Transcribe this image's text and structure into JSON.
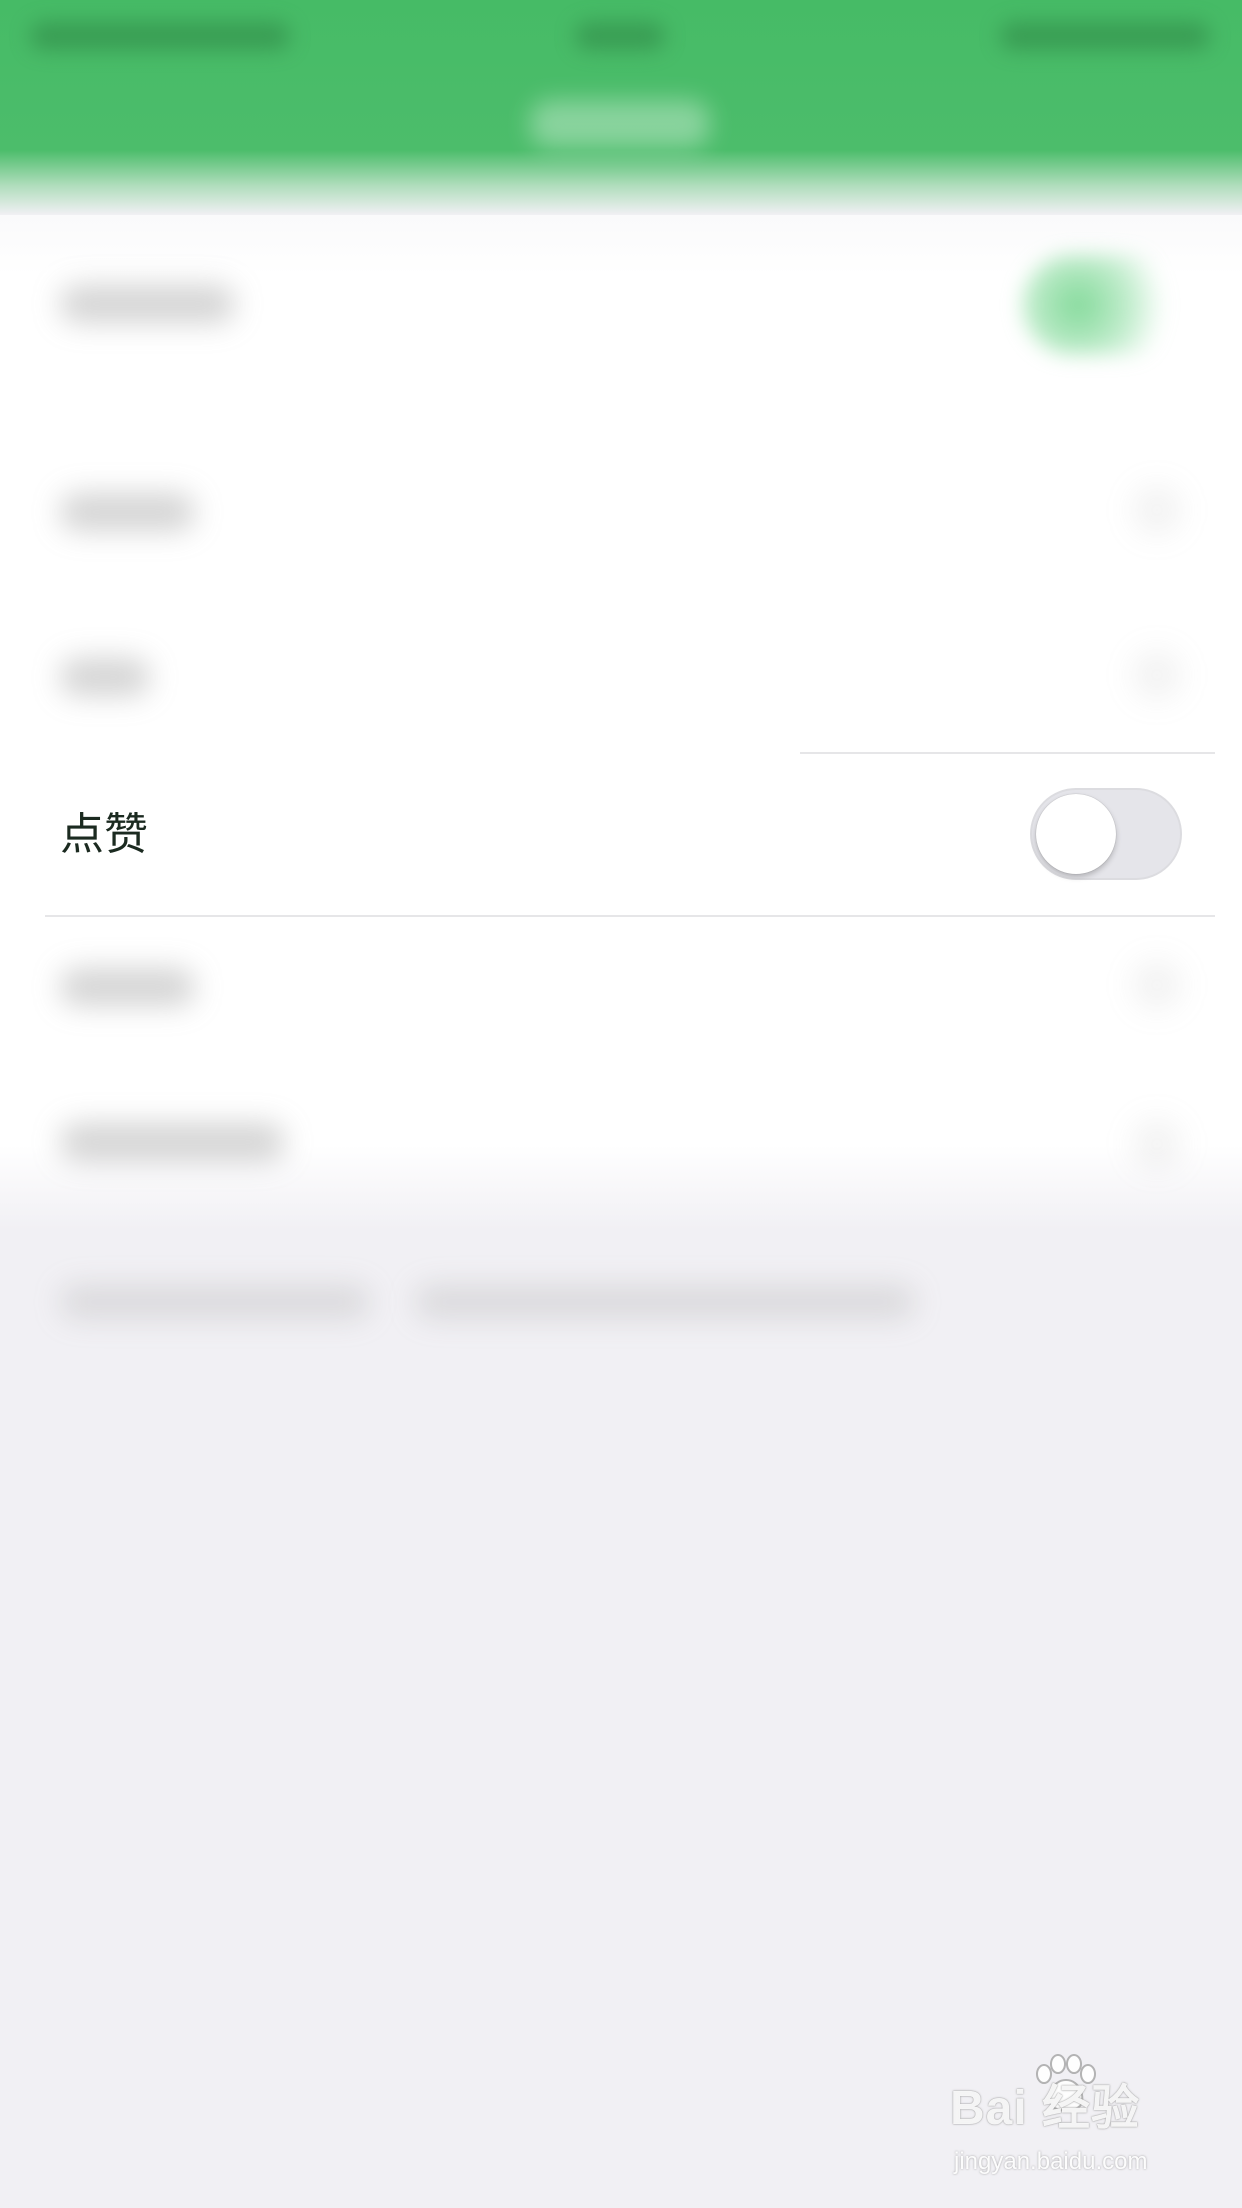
{
  "settings": {
    "like_row": {
      "label": "点赞",
      "toggle_on": false
    }
  },
  "colors": {
    "header_green": "#46bb66",
    "toggle_off_track": "#e5e5ea",
    "background": "#f1f0f4"
  },
  "watermark": {
    "brand": "Bai  经验",
    "url": "jingyan.baidu.com"
  }
}
